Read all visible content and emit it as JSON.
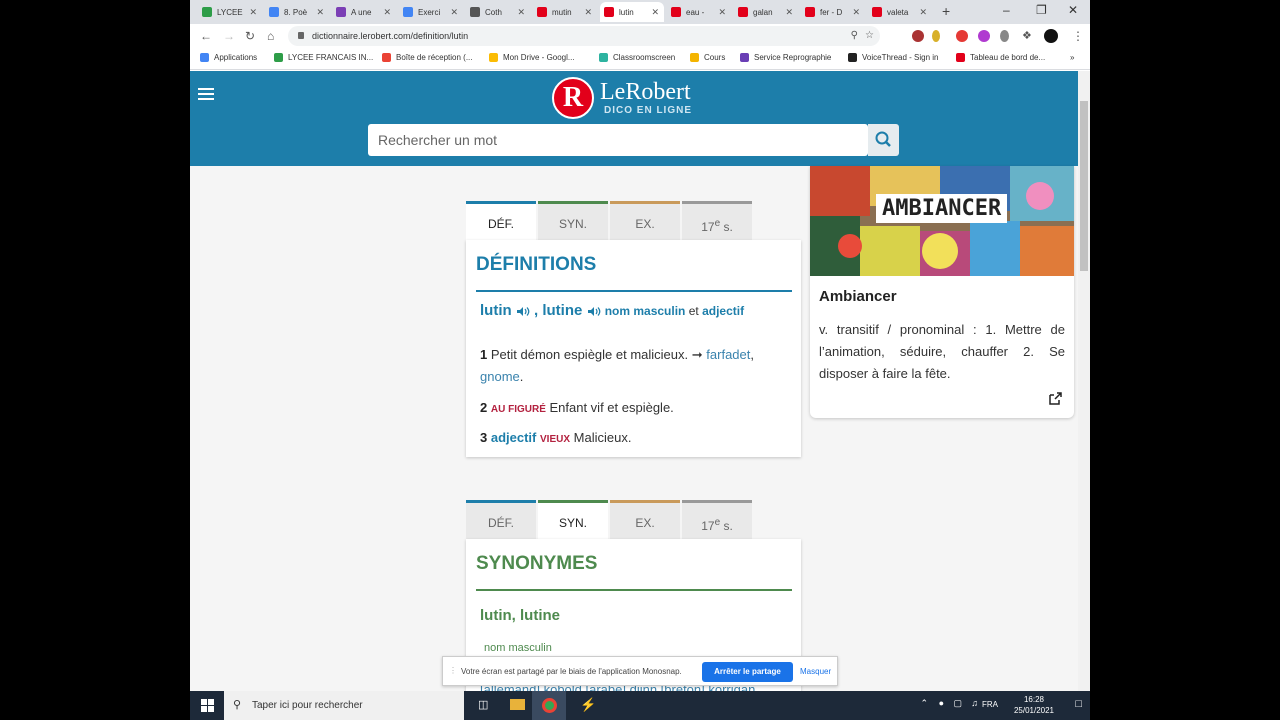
{
  "browser": {
    "tabs": [
      {
        "label": "LYCEE",
        "color": "#2e9d48"
      },
      {
        "label": "8. Poè",
        "color": "#4285f4"
      },
      {
        "label": "A une",
        "color": "#7b3fb5"
      },
      {
        "label": "Exerci",
        "color": "#4285f4"
      },
      {
        "label": "Coth",
        "color": "#555555"
      },
      {
        "label": "mutin",
        "color": "#e2001a"
      },
      {
        "label": "lutin",
        "color": "#e2001a"
      },
      {
        "label": "eau -",
        "color": "#e2001a"
      },
      {
        "label": "galan",
        "color": "#e2001a"
      },
      {
        "label": "fer - D",
        "color": "#e2001a"
      },
      {
        "label": "valeta",
        "color": "#e2001a"
      }
    ],
    "new_tab": "+",
    "url": "dictionnaire.lerobert.com/definition/lutin",
    "bookmarks": [
      {
        "label": "Applications",
        "color": "#4285f4"
      },
      {
        "label": "LYCEE FRANCAIS IN...",
        "color": "#2e9d48"
      },
      {
        "label": "Boîte de réception (...",
        "color": "#ea4335"
      },
      {
        "label": "Mon Drive - Googl...",
        "color": "#fbbc04"
      },
      {
        "label": "Classroomscreen",
        "color": "#2db3a0"
      },
      {
        "label": "Cours",
        "color": "#f4b400"
      },
      {
        "label": "Service Reprographie",
        "color": "#6a3fb5"
      },
      {
        "label": "VoiceThread - Sign in",
        "color": "#222222"
      },
      {
        "label": "Tableau de bord de...",
        "color": "#e2001a"
      }
    ],
    "bookmarks_more": "»"
  },
  "site": {
    "logo_letter": "R",
    "logo_name": "LeRobert",
    "logo_sub": "DICO EN LIGNE",
    "search_placeholder": "Rechercher un mot"
  },
  "tabs": {
    "def": "DÉF.",
    "syn": "SYN.",
    "ex": "EX.",
    "century": "17",
    "century_sup": "e",
    "century_suffix": " s."
  },
  "definitions": {
    "title": "DÉFINITIONS",
    "word1": "lutin",
    "sep": " , ",
    "word2": "lutine",
    "gram1": "nom masculin",
    "et": " et ",
    "gram2": "adjectif",
    "sense1_num": "1",
    "sense1_text": "Petit démon espiègle et malicieux. ",
    "arrow": "➞",
    "link1": "farfadet",
    "comma": ", ",
    "link2": "gnome",
    "period": ".",
    "sense2_num": "2",
    "sense2_tag": "AU FIGURÉ",
    "sense2_text": "Enfant vif et espiègle.",
    "sense3_num": "3",
    "sense3_kw": "adjectif",
    "sense3_tag": "VIEUX",
    "sense3_text": "Malicieux."
  },
  "synonymes": {
    "title": "SYNONYMES",
    "entry": "lutin, lutine",
    "gram": "nom masculin",
    "partial_line": "[allemand] kobold [arabe] djinn [breton] korrigan"
  },
  "side": {
    "image_title": "AMBIANCER",
    "title": "Ambiancer",
    "text": "v. transitif / pronominal : 1. Mettre de l’animation, séduire, chauffer 2. Se disposer à faire la fête."
  },
  "share_bar": {
    "text": "Votre écran est partagé par le biais de l'application Monosnap.",
    "stop": "Arrêter le partage",
    "hide": "Masquer"
  },
  "taskbar": {
    "search": "Taper ici pour rechercher",
    "lang": "FRA",
    "time": "16:28",
    "date": "25/01/2021"
  },
  "colors": {
    "brand_blue": "#1d7eaa",
    "def_green": "#4e8a4e",
    "tab_def_border": "#1d7eaa",
    "tab_syn_border": "#4e8a4e",
    "tab_ex_border": "#c99a5b",
    "tab_century_border": "#999999"
  }
}
